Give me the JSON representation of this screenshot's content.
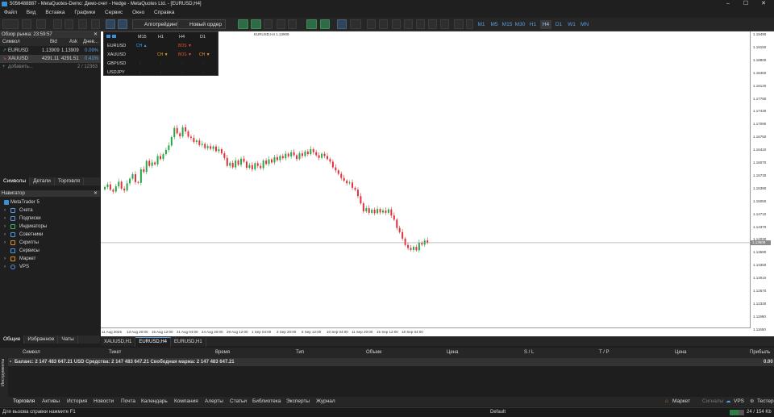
{
  "window": {
    "title": "5056488887 - MetaQuotes-Demo: Демо-счет - Hedge - MetaQuotes Ltd. - [EURUSD,H4]"
  },
  "menu": [
    "Файл",
    "Вид",
    "Вставка",
    "Графики",
    "Сервис",
    "Окно",
    "Справка"
  ],
  "toolbar": {
    "algo_trading": "Алготрейдинг",
    "new_order": "Новый ордер",
    "timeframes": [
      "M1",
      "M5",
      "M15",
      "M30",
      "H1",
      "H4",
      "D1",
      "W1",
      "MN"
    ],
    "active_timeframe": "H4"
  },
  "market_watch": {
    "title": "Обзор рынка: 23:59:57",
    "columns": [
      "Символ",
      "Bid",
      "Ask",
      "Днев..."
    ],
    "rows": [
      {
        "symbol": "EURUSD",
        "bid": "1.13909",
        "ask": "1.13909",
        "change": "0.09%"
      },
      {
        "symbol": "XAUUSD",
        "bid": "4291.11",
        "ask": "4291.51",
        "change": "0.41%"
      }
    ],
    "add_label": "добавить...",
    "count": "2 / 12363",
    "tabs": [
      "Символы",
      "Детали",
      "Торговля"
    ]
  },
  "navigator": {
    "title": "Навигатор",
    "root": "MetaTrader 5",
    "items": [
      "Счета",
      "Подписки",
      "Индикаторы",
      "Советники",
      "Скрипты",
      "Сервисы",
      "Маркет",
      "VPS"
    ],
    "tabs": [
      "Общие",
      "Избранное",
      "Чаты"
    ]
  },
  "mtf_panel": {
    "headers": [
      "M15",
      "H1",
      "H4",
      "D1"
    ],
    "symbols": [
      "EURUSD",
      "XAUUSD",
      "GBPUSD",
      "USDJPY"
    ],
    "cells": [
      [
        "CH ▲",
        "",
        "BOS ▼",
        ""
      ],
      [
        "",
        "CH ▼",
        "BOS ▼",
        "CH ▼"
      ],
      [
        "·",
        "·",
        "·",
        "·"
      ],
      [
        "·",
        "·",
        "·",
        "·"
      ]
    ],
    "cell_colors": {
      "up": "#3fa0ff",
      "down": "#e8503a",
      "orange": "#f0a020"
    }
  },
  "chart": {
    "symbol_label": "EURUSD,H4  1.13909",
    "price_line_value": "1.13909",
    "y_ticks": [
      "1.19490",
      "1.19150",
      "1.18800",
      "1.18460",
      "1.18120",
      "1.17780",
      "1.17430",
      "1.17090",
      "1.16750",
      "1.16410",
      "1.16070",
      "1.15730",
      "1.15390",
      "1.15050",
      "1.14710",
      "1.14370",
      "1.14030",
      "1.13690",
      "1.13350",
      "1.13010",
      "1.12670",
      "1.12330",
      "1.11990",
      "1.11650"
    ],
    "x_ticks": [
      "11 Aug 2026",
      "13 Aug 20:00",
      "15 Aug 12:00",
      "21 Aug 04:00",
      "24 Aug 20:00",
      "28 Aug 12:00",
      "1 Sep 04:00",
      "3 Sep 20:00",
      "5 Sep 12:00",
      "10 Sep 04:00",
      "11 Sep 20:00",
      "15 Sep 12:00",
      "18 Sep 04:00"
    ]
  },
  "chart_data": {
    "type": "candlestick",
    "symbol": "EURUSD",
    "timeframe": "H4",
    "ylim": [
      1.1165,
      1.1949
    ],
    "close_series": [
      1.1538,
      1.1545,
      1.1531,
      1.1526,
      1.154,
      1.1552,
      1.1534,
      1.1529,
      1.1548,
      1.156,
      1.1572,
      1.1551,
      1.1549,
      1.1585,
      1.1578,
      1.1607,
      1.1594,
      1.1603,
      1.1598,
      1.162,
      1.1612,
      1.1625,
      1.1636,
      1.1648,
      1.167,
      1.1694,
      1.168,
      1.1672,
      1.1696,
      1.1685,
      1.1671,
      1.1668,
      1.1657,
      1.1661,
      1.1649,
      1.1652,
      1.1641,
      1.1646,
      1.1639,
      1.1645,
      1.1633,
      1.1638,
      1.1627,
      1.1615,
      1.1594,
      1.1602,
      1.159,
      1.1608,
      1.1597,
      1.1613,
      1.1605,
      1.1589,
      1.1596,
      1.1585,
      1.1601,
      1.1594,
      1.1588,
      1.1608,
      1.1599,
      1.1611,
      1.1603,
      1.1617,
      1.1609,
      1.162,
      1.1614,
      1.1626,
      1.1619,
      1.163,
      1.1622,
      1.1612,
      1.1627,
      1.162,
      1.1632,
      1.1625,
      1.1638,
      1.163,
      1.1622,
      1.1615,
      1.1626,
      1.162,
      1.1612,
      1.1605,
      1.159,
      1.1582,
      1.1573,
      1.1562,
      1.1555,
      1.1548,
      1.155,
      1.1536,
      1.1531,
      1.1514,
      1.1495,
      1.1474,
      1.1482,
      1.147,
      1.1478,
      1.1469,
      1.148,
      1.1471,
      1.1476,
      1.147,
      1.1479,
      1.1463,
      1.1452,
      1.143,
      1.1419,
      1.1402,
      1.1385,
      1.1377,
      1.1372,
      1.138,
      1.1371,
      1.1391,
      1.1386,
      1.1397,
      1.1391
    ]
  },
  "chart_tabs": [
    "XAUUSD,H1",
    "EURUSD,H4",
    "EURUSD,H1"
  ],
  "active_chart_tab": "EURUSD,H4",
  "terminal": {
    "side_label": "Инструменты",
    "columns": [
      "Символ",
      "Тикет",
      "Время",
      "Тип",
      "Объем",
      "Цена",
      "S / L",
      "T / P",
      "Цена",
      "Прибыль"
    ],
    "balance_line": "Баланс: 2 147 483 647.21 USD  Средства: 2 147 483 647.21  Свободная маржа: 2 147 483 647.21",
    "profit": "0.00",
    "tabs": [
      "Торговля",
      "Активы",
      "История",
      "Новости",
      "Почта",
      "Календарь",
      "Компания",
      "Алерты",
      "Статьи",
      "Библиотека",
      "Эксперты",
      "Журнал"
    ],
    "right_tabs": [
      "Маркет",
      "Сигналы",
      "VPS",
      "Тестер"
    ]
  },
  "status": {
    "help": "Для вызова справки нажмите F1",
    "profile": "Default",
    "connection": "24 / 154 Kb"
  },
  "colors": {
    "bull": "#26a645",
    "bear": "#e0303a",
    "accent": "#5b9fe3"
  }
}
